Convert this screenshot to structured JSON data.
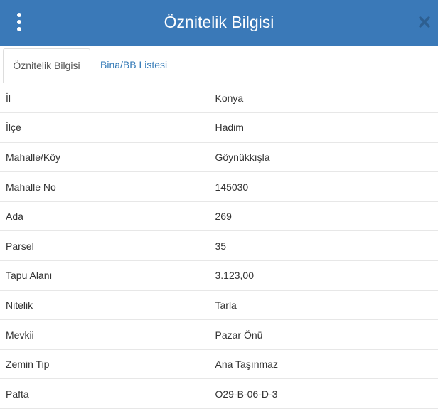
{
  "header": {
    "title": "Öznitelik Bilgisi",
    "menu_icon": "kebab-menu-icon",
    "close_icon": "close-icon",
    "background_color": "#3a79b8"
  },
  "tabs": [
    {
      "label": "Öznitelik Bilgisi",
      "active": true
    },
    {
      "label": "Bina/BB Listesi",
      "active": false
    }
  ],
  "attributes": [
    {
      "key": "İl",
      "value": "Konya"
    },
    {
      "key": "İlçe",
      "value": "Hadim"
    },
    {
      "key": "Mahalle/Köy",
      "value": "Göynükkışla"
    },
    {
      "key": "Mahalle No",
      "value": "145030"
    },
    {
      "key": "Ada",
      "value": "269"
    },
    {
      "key": "Parsel",
      "value": "35"
    },
    {
      "key": "Tapu Alanı",
      "value": "3.123,00"
    },
    {
      "key": "Nitelik",
      "value": "Tarla"
    },
    {
      "key": "Mevkii",
      "value": "Pazar Önü"
    },
    {
      "key": "Zemin Tip",
      "value": "Ana Taşınmaz"
    },
    {
      "key": "Pafta",
      "value": "O29-B-06-D-3"
    }
  ]
}
